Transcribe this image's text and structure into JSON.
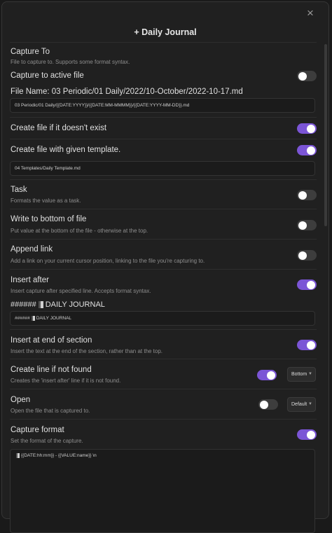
{
  "modal": {
    "title": "+ Daily Journal",
    "close_icon": "×"
  },
  "capture_to": {
    "label": "Capture To",
    "desc": "File to capture to. Supports some format syntax."
  },
  "capture_active": {
    "label": "Capture to active file",
    "enabled": false
  },
  "file_name": {
    "label": "File Name: 03 Periodic/01 Daily/2022/10-October/2022-10-17.md",
    "value": "03 Periodic/01 Daily/{{DATE:YYYY}}/{{DATE:MM-MMMM}}/{{DATE:YYYY-MM-DD}}.md"
  },
  "create_if_missing": {
    "label": "Create file if it doesn't exist",
    "enabled": true
  },
  "create_template": {
    "label": "Create file with given template.",
    "enabled": true,
    "value": "04 Templates/Daily Template.md"
  },
  "task": {
    "label": "Task",
    "desc": "Formats the value as a task.",
    "enabled": false
  },
  "write_bottom": {
    "label": "Write to bottom of file",
    "desc": "Put value at the bottom of the file - otherwise at the top.",
    "enabled": false
  },
  "append_link": {
    "label": "Append link",
    "desc": "Add a link on your current cursor position, linking to the file you're capturing to.",
    "enabled": false
  },
  "insert_after": {
    "label": "Insert after",
    "desc": "Insert capture after specified line. Accepts format syntax.",
    "enabled": true,
    "heading_prefix": "######",
    "heading_text": "DAILY JOURNAL",
    "input_prefix": "######",
    "input_text": "DAILY JOURNAL"
  },
  "insert_end_section": {
    "label": "Insert at end of section",
    "desc": "Insert the text at the end of the section, rather than at the top.",
    "enabled": true
  },
  "create_line": {
    "label": "Create line if not found",
    "desc": "Creates the 'insert after' line if it is not found.",
    "enabled": true,
    "select_value": "Bottom"
  },
  "open": {
    "label": "Open",
    "desc": "Open the file that is captured to.",
    "enabled": false,
    "select_value": "Default"
  },
  "capture_format": {
    "label": "Capture format",
    "desc": "Set the format of the capture.",
    "enabled": true,
    "value": "{{DATE:hh:mm}} - {{VALUE:name}} \\n"
  },
  "colors": {
    "accent": "#7b55d6",
    "toggle_off": "#3d3d3d",
    "background": "#202020"
  },
  "icons": {
    "close": "close-icon",
    "chevron": "chevron-down-icon",
    "doc": "document-icon"
  }
}
